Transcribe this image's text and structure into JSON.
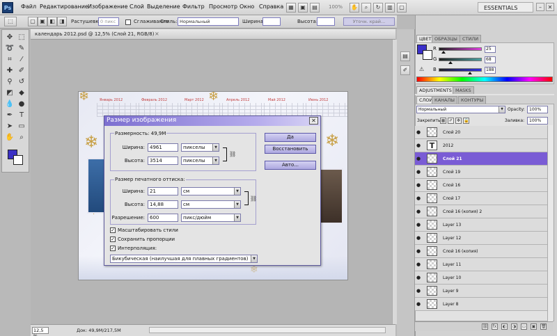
{
  "app": {
    "logo": "Ps",
    "menu": [
      "Файл",
      "Редактирование",
      "Изображение",
      "Слой",
      "Выделение",
      "Фильтр",
      "Просмотр",
      "Окно",
      "Справка"
    ],
    "zoom_readout": "100%",
    "workspace": "ESSENTIALS",
    "window_buttons": [
      "–",
      "□",
      "✕"
    ]
  },
  "options_bar": {
    "feather_label": "Растушевка:",
    "feather_value": "0 пикс",
    "antialias_label": "Сглаживание",
    "style_label": "Стиль:",
    "style_value": "Нормальный",
    "width_label": "Ширина:",
    "height_label": "Высота:",
    "refine_edge": "Уточн. край..."
  },
  "document": {
    "tab_title": "календарь 2012.psd @ 12,5% (Слой 21, RGB/8)",
    "close": "×",
    "status_zoom": "12,5 %",
    "status_doc": "Док: 49,9M/217,5M"
  },
  "artwork": {
    "months": [
      "Январь 2012",
      "Февраль 2012",
      "Март 2012",
      "Апрель 2012",
      "Май 2012",
      "Июнь 2012"
    ]
  },
  "dialog": {
    "title": "Размер изображения",
    "close": "✕",
    "pixel_dims_legend": "Размерность:",
    "pixel_dims_value": "49,9M",
    "width_label": "Ширина:",
    "width_value": "4961",
    "width_unit": "пикселы",
    "height_label": "Высота:",
    "height_value": "3514",
    "height_unit": "пикселы",
    "print_legend": "Размер печатного оттиска:",
    "print_width_label": "Ширина:",
    "print_width_value": "21",
    "print_width_unit": "см",
    "print_height_label": "Высота:",
    "print_height_value": "14,88",
    "print_height_unit": "см",
    "resolution_label": "Разрешение:",
    "resolution_value": "600",
    "resolution_unit": "пикс/дюйм",
    "ok": "Да",
    "reset": "Восстановить",
    "auto": "Авто...",
    "scale_styles": "Масштабировать стили",
    "constrain": "Сохранить пропорции",
    "resample": "Интерполяция:",
    "resample_method": "Бикубическая (наилучшая для плавных градиентов)",
    "check_mark": "✓"
  },
  "color_panel": {
    "tabs": [
      "ЦВЕТ",
      "ОБРАЗЦЫ",
      "СТИЛИ"
    ],
    "channels": [
      {
        "name": "R",
        "value": "25",
        "level": 0.1,
        "color": "#e040e0"
      },
      {
        "name": "G",
        "value": "68",
        "level": 0.27,
        "color": "#4aa0a0"
      },
      {
        "name": "B",
        "value": "188",
        "level": 0.74,
        "color": "#3030e0"
      }
    ]
  },
  "adjust_tabs": [
    "ADJUSTMENTS",
    "MASKS"
  ],
  "layers_panel": {
    "tabs": [
      "СЛОИ",
      "КАНАЛЫ",
      "КОНТУРЫ"
    ],
    "blend_mode": "Нормальный",
    "opacity_label": "Opacity:",
    "opacity_value": "100%",
    "lock_label": "Закрепить:",
    "fill_label": "Заливка:",
    "fill_value": "100%",
    "layers": [
      {
        "name": "Слой 20",
        "type": "raster",
        "selected": false
      },
      {
        "name": "2012",
        "type": "text",
        "selected": false
      },
      {
        "name": "Слой 21",
        "type": "raster",
        "selected": true
      },
      {
        "name": "Слой 19",
        "type": "raster",
        "selected": false
      },
      {
        "name": "Слой 16",
        "type": "raster",
        "selected": false
      },
      {
        "name": "Слой 17",
        "type": "raster",
        "selected": false
      },
      {
        "name": "Слой 16 (копия) 2",
        "type": "raster",
        "selected": false
      },
      {
        "name": "Layer 13",
        "type": "raster",
        "selected": false
      },
      {
        "name": "Layer 12",
        "type": "raster",
        "selected": false
      },
      {
        "name": "Слой 16 (копия)",
        "type": "raster",
        "selected": false
      },
      {
        "name": "Layer 11",
        "type": "raster",
        "selected": false
      },
      {
        "name": "Layer 10",
        "type": "raster",
        "selected": false
      },
      {
        "name": "Layer 9",
        "type": "raster",
        "selected": false
      },
      {
        "name": "Layer 8",
        "type": "raster",
        "selected": false
      }
    ],
    "text_glyph": "T",
    "eye_glyph": "●"
  }
}
